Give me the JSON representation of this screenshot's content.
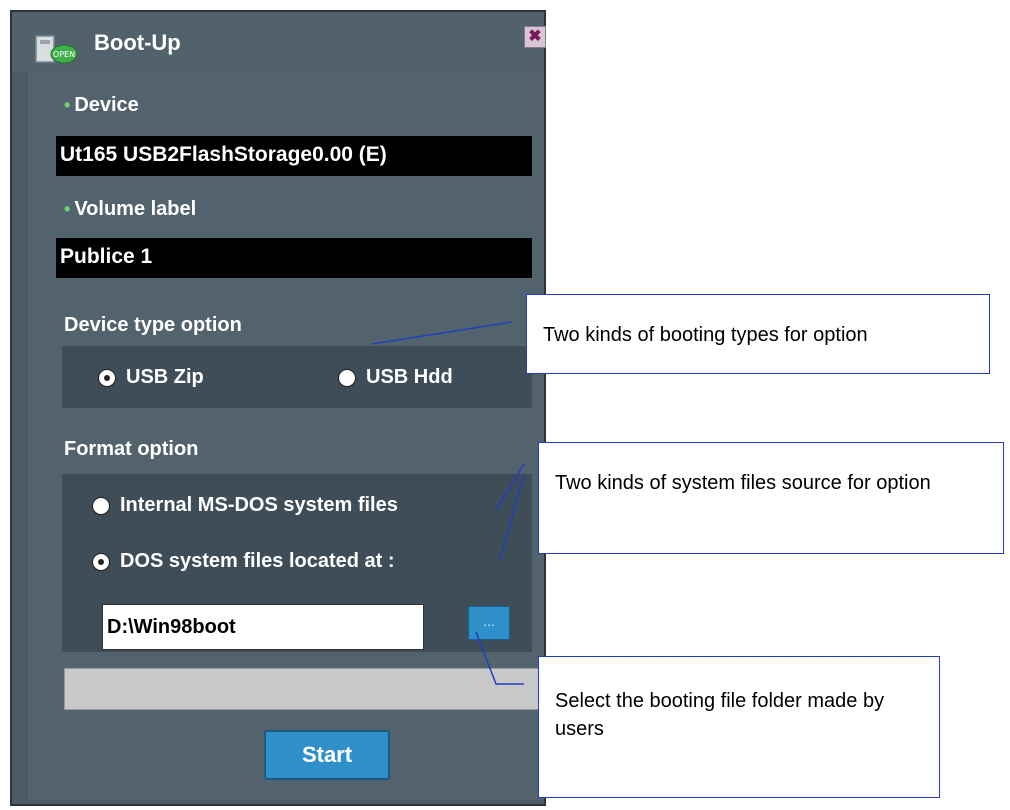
{
  "window": {
    "title": "Boot-Up",
    "close_glyph": "✖",
    "app_icon_text": "OPEN"
  },
  "device": {
    "label": "Device",
    "value": "Ut165   USB2FlashStorage0.00  (E)"
  },
  "volume": {
    "label": "Volume label",
    "value": "Publice 1"
  },
  "device_type": {
    "label": "Device type option",
    "options": [
      {
        "label": "USB Zip",
        "selected": true
      },
      {
        "label": "USB Hdd",
        "selected": false
      }
    ]
  },
  "format": {
    "label": "Format option",
    "options": [
      {
        "label": "Internal MS-DOS system files",
        "selected": false
      },
      {
        "label": "DOS system files located at :",
        "selected": true
      }
    ],
    "path_value": "D:\\Win98boot",
    "browse_label": "..."
  },
  "progress": {
    "value": 0
  },
  "start_label": "Start",
  "callouts": {
    "booting_types": "Two kinds of booting types for option",
    "system_files": "Two kinds of system files source for option",
    "folder": "Select the booting file folder made by users"
  },
  "colors": {
    "window_bg": "#4a5b66",
    "field_bg": "#000000",
    "accent_blue": "#2f8fc8",
    "callout_border": "#1f3fbf",
    "bullet_green": "#6fd16f"
  }
}
